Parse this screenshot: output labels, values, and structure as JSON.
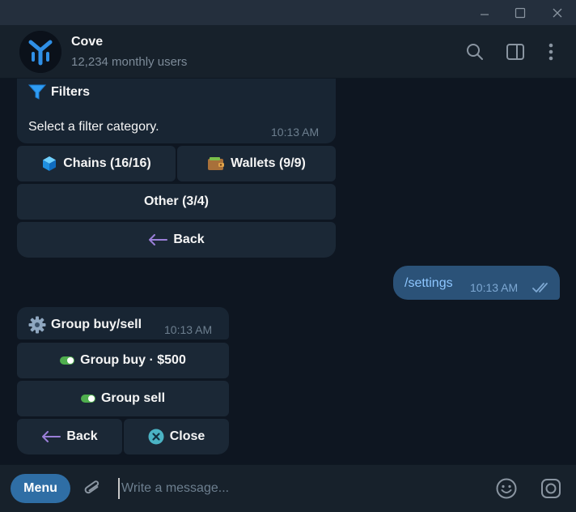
{
  "chat": {
    "name": "Cove",
    "subtitle": "12,234 monthly users"
  },
  "messages": {
    "filters": {
      "title": "Filters",
      "text": "Select a filter category.",
      "time": "10:13 AM",
      "buttons": {
        "chains": "Chains (16/16)",
        "wallets": "Wallets (9/9)",
        "other": "Other (3/4)",
        "back": "Back"
      }
    },
    "settings": {
      "text": "/settings",
      "time": "10:13 AM"
    },
    "group": {
      "title": "Group buy/sell",
      "time": "10:13 AM",
      "buttons": {
        "group_buy": "Group buy · $500",
        "group_sell": "Group sell",
        "back": "Back",
        "close": "Close"
      }
    }
  },
  "composer": {
    "menu_label": "Menu",
    "placeholder": "Write a message..."
  },
  "colors": {
    "accent": "#2f6ea5",
    "outgoing_bubble": "#2b5278",
    "incoming_bubble": "#182533",
    "toggle_on": "#4fae4e"
  }
}
